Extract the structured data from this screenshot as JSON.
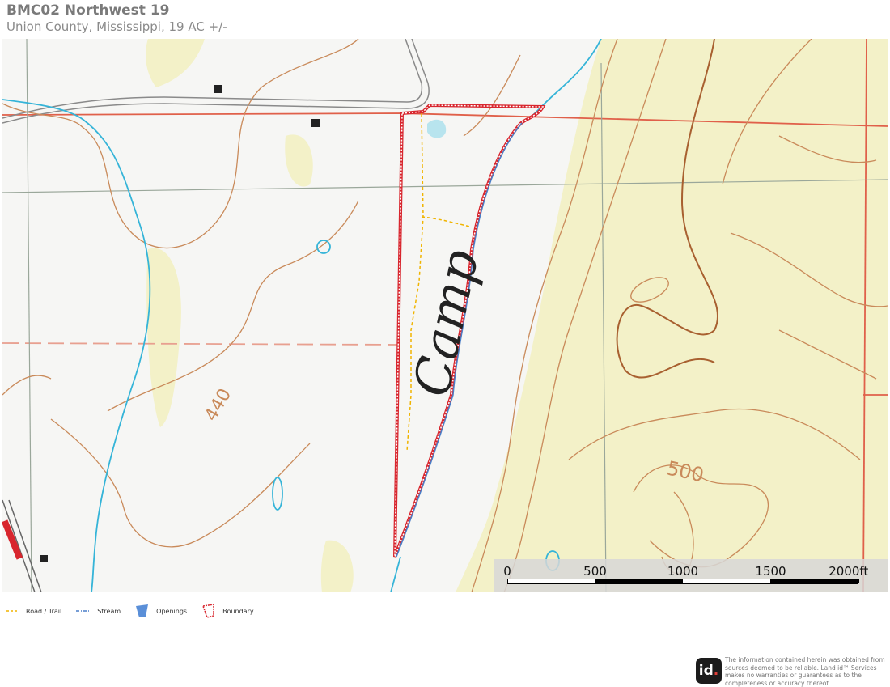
{
  "header": {
    "title": "BMC02 Northwest 19",
    "subtitle": "Union County, Mississippi, 19 AC +/-"
  },
  "map": {
    "place_label": "Camp",
    "contour_labels": [
      "440",
      "500"
    ],
    "colors": {
      "boundary": "#d8262e",
      "stream": "#4a7fc8",
      "road_trail": "#f0b400",
      "contour": "#c98a5a",
      "section_line": "#e0604a",
      "water": "#35b4d8",
      "woodland": "#f3f1c8"
    }
  },
  "scalebar": {
    "labels": [
      "0",
      "500",
      "1000",
      "1500",
      "2000ft"
    ]
  },
  "legend": {
    "items": [
      {
        "label": "Road / Trail",
        "icon": "dashed-line-icon"
      },
      {
        "label": "Stream",
        "icon": "dash-dot-line-icon"
      },
      {
        "label": "Openings",
        "icon": "polygon-fill-icon"
      },
      {
        "label": "Boundary",
        "icon": "polygon-outline-icon"
      }
    ]
  },
  "footer": {
    "logo_text": "id",
    "logo_dot": ".",
    "disclaimer": "The information contained herein was obtained from sources deemed to be reliable. Land id™ Services makes no warranties or guarantees as to the completeness or accuracy thereof."
  }
}
